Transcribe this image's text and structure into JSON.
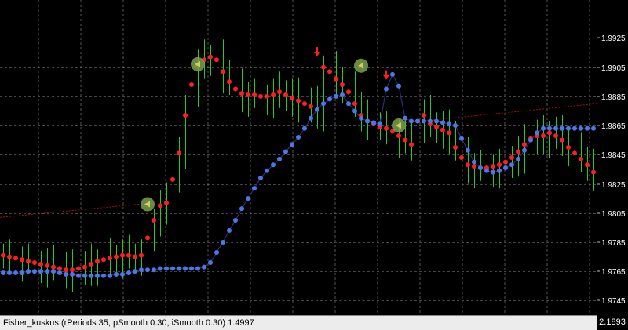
{
  "colors": {
    "background": "#000000",
    "grid": "#8a8a8a",
    "candle": "#22cc22",
    "red_dot": "#ff1e1e",
    "blue_dot": "#4a78e8",
    "blue_line": "#2d2d78",
    "red_dash": "#cc1010",
    "signal_circle": "#7aa24a",
    "signal_fill": "#d8c86a"
  },
  "price_axis": {
    "labels": [
      "1.9925",
      "1.9905",
      "1.9885",
      "1.9865",
      "1.9845",
      "1.9825",
      "1.9805",
      "1.9785",
      "1.9765",
      "1.9745"
    ],
    "ylim": [
      1.9735,
      1.9951
    ]
  },
  "indicator": {
    "status_text": "Fisher_kuskus (rPeriods 35, pSmooth 0.30, iSmooth 0.30) 1.4997",
    "subwindow_price": "2.1893"
  },
  "chart_data": {
    "type": "line",
    "bar_count": 95,
    "series": [
      {
        "values": [
          1.9776,
          1.9775,
          1.9774,
          1.9773,
          1.9772,
          1.9771,
          1.977,
          1.9769,
          1.9768,
          1.9767,
          1.9766,
          1.9766,
          1.9767,
          1.9768,
          1.977,
          1.9772,
          1.9773,
          1.9774,
          1.9775,
          1.9776,
          1.9776,
          1.9775,
          1.9776,
          1.9788,
          1.98,
          1.981,
          1.9812,
          1.9828,
          1.9846,
          1.9872,
          1.9893,
          1.9906,
          1.991,
          1.9912,
          1.991,
          1.9902,
          1.9895,
          1.989,
          1.9887,
          1.9886,
          1.9886,
          1.9885,
          1.9885,
          1.9886,
          1.9888,
          1.9886,
          1.9884,
          1.9882,
          1.988,
          1.9878,
          1.9876,
          1.9905,
          1.9902,
          1.9897,
          1.9893,
          1.9888,
          1.988,
          1.9872,
          1.9868,
          1.9866,
          1.9864,
          1.9863,
          1.9861,
          1.9858,
          1.9855,
          1.9852,
          1.9868,
          1.9872,
          1.9866,
          1.9864,
          1.9862,
          1.986,
          1.985,
          1.9843,
          1.9838,
          1.9837,
          1.9836,
          1.9836,
          1.9837,
          1.9838,
          1.984,
          1.9843,
          1.9847,
          1.9852,
          1.9856,
          1.9858,
          1.9858,
          1.986,
          1.9858,
          1.9855,
          1.985,
          1.9846,
          1.9842,
          1.9838,
          1.9833
        ]
      },
      {
        "values": [
          1.9764,
          1.9764,
          1.9764,
          1.9764,
          1.9765,
          1.9765,
          1.9765,
          1.9765,
          1.9765,
          1.9764,
          1.9763,
          1.9763,
          1.9762,
          1.9762,
          1.9762,
          1.9762,
          1.9762,
          1.9762,
          1.9763,
          1.9763,
          1.9764,
          1.9765,
          1.9766,
          1.9766,
          1.9766,
          1.9767,
          1.9767,
          1.9767,
          1.9767,
          1.9767,
          1.9767,
          1.9767,
          1.9768,
          1.9771,
          1.9778,
          1.9785,
          1.9793,
          1.98,
          1.9808,
          1.9815,
          1.9822,
          1.9829,
          1.9834,
          1.9838,
          1.9842,
          1.9847,
          1.9852,
          1.9857,
          1.9863,
          1.987,
          1.9876,
          1.988,
          1.9883,
          1.9885,
          1.9886,
          1.988,
          1.9875,
          1.987,
          1.9868,
          1.9867,
          1.9866,
          1.989,
          1.99,
          1.9892,
          1.987,
          1.9868,
          1.9868,
          1.9868,
          1.9868,
          1.9868,
          1.9867,
          1.9866,
          1.9865,
          1.9856,
          1.9848,
          1.984,
          1.9836,
          1.9834,
          1.9833,
          1.9834,
          1.9836,
          1.9838,
          1.9842,
          1.9848,
          1.9855,
          1.986,
          1.9863,
          1.9863,
          1.9863,
          1.9863,
          1.9863,
          1.9863,
          1.9863,
          1.9863,
          1.9863
        ]
      }
    ]
  }
}
